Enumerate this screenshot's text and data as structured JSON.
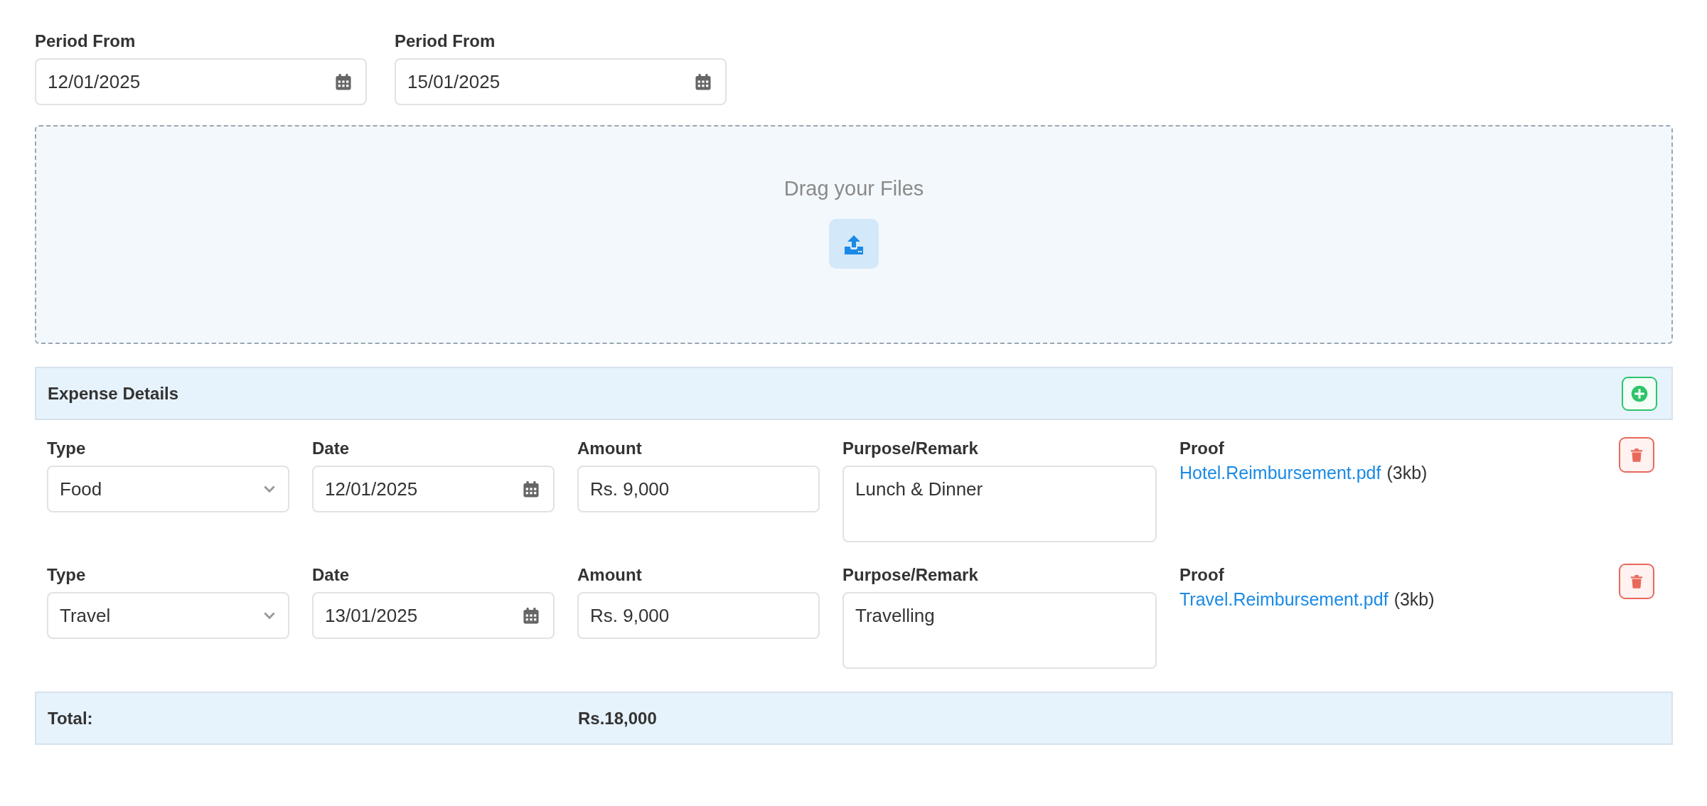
{
  "period": [
    {
      "label": "Period From",
      "value": "12/01/2025"
    },
    {
      "label": "Period From",
      "value": "15/01/2025"
    }
  ],
  "dropzone": {
    "text": "Drag your Files"
  },
  "expense_details": {
    "title": "Expense Details",
    "rows": [
      {
        "type_label": "Type",
        "type": "Food",
        "date_label": "Date",
        "date": "12/01/2025",
        "amount_label": "Amount",
        "amount": "Rs. 9,000",
        "remark_label": "Purpose/Remark",
        "remark": "Lunch & Dinner",
        "proof_label": "Proof",
        "file": "Hotel.Reimbursement.pdf",
        "size": "(3kb)"
      },
      {
        "type_label": "Type",
        "type": "Travel",
        "date_label": "Date",
        "date": "13/01/2025",
        "amount_label": "Amount",
        "amount": "Rs. 9,000",
        "remark_label": "Purpose/Remark",
        "remark": "Travelling",
        "proof_label": "Proof",
        "file": "Travel.Reimbursement.pdf",
        "size": "(3kb)"
      }
    ]
  },
  "total": {
    "label": "Total:",
    "value": "Rs.18,000"
  }
}
